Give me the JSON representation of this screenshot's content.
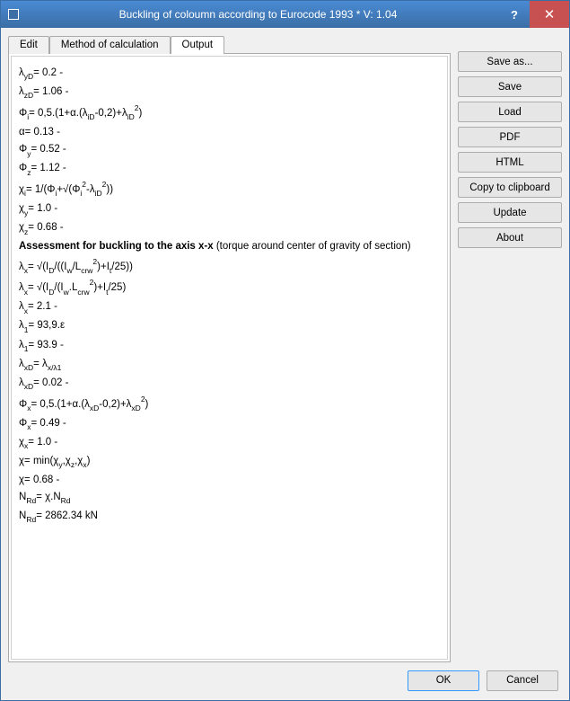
{
  "window": {
    "title": "Buckling of coloumn according to Eurocode 1993 * V: 1.04",
    "help": "?",
    "close": "✕"
  },
  "tabs": {
    "edit": "Edit",
    "method": "Method of calculation",
    "output": "Output"
  },
  "side": {
    "saveas": "Save as...",
    "save": "Save",
    "load": "Load",
    "pdf": "PDF",
    "html": "HTML",
    "copy": "Copy to clipboard",
    "update": "Update",
    "about": "About"
  },
  "footer": {
    "ok": "OK",
    "cancel": "Cancel"
  },
  "output": {
    "l1": "λ_{yD}= 0.2 -",
    "l2": "λ_{zD}= 1.06 -",
    "l3": "Φ_{i}= 0,5.(1+α.(λ_{iD}-0,2)+λ_{iD}^{2})",
    "l4": "α= 0.13 -",
    "l5": "Φ_{y}= 0.52 -",
    "l6": "Φ_{z}= 1.12 -",
    "l7": "χ_{i}= 1/(Φ_{i}+√(Φ_{i}^{2}-λ_{iD}^{2}))",
    "l8": "χ_{y}= 1.0 -",
    "l9": "χ_{z}= 0.68 -",
    "heading_bold": "Assessment for buckling to the axis x-x",
    "heading_rest": " (torque around center of gravity of section)",
    "l10": "λ_{x}= √(I_{D}/((I_{w}/L_{crw}^{2})+I_{t}/25))",
    "l11": "λ_{x}= √(I_{D}/(I_{w}.L_{crw}^{2})+I_{t}/25)",
    "l12": "λ_{x}= 2.1 -",
    "l13": "λ_{1}= 93,9.ε",
    "l14": "λ_{1}= 93.9 -",
    "l15": "λ_{xD}= λ_{x/λ1}",
    "l16": "λ_{xD}= 0.02 -",
    "l17": "Φ_{x}= 0,5.(1+α.(λ_{xD}-0,2)+λ_{xD}^{2})",
    "l18": "Φ_{x}= 0.49 -",
    "l19": "χ_{x}= 1.0 -",
    "l20": "χ= min(χ_{y},χ_{z},χ_{x})",
    "l21": "χ= 0.68 -",
    "l22": "N_{Rd}= χ.N_{Rd}",
    "l23": "N_{Rd}= 2862.34 kN"
  }
}
